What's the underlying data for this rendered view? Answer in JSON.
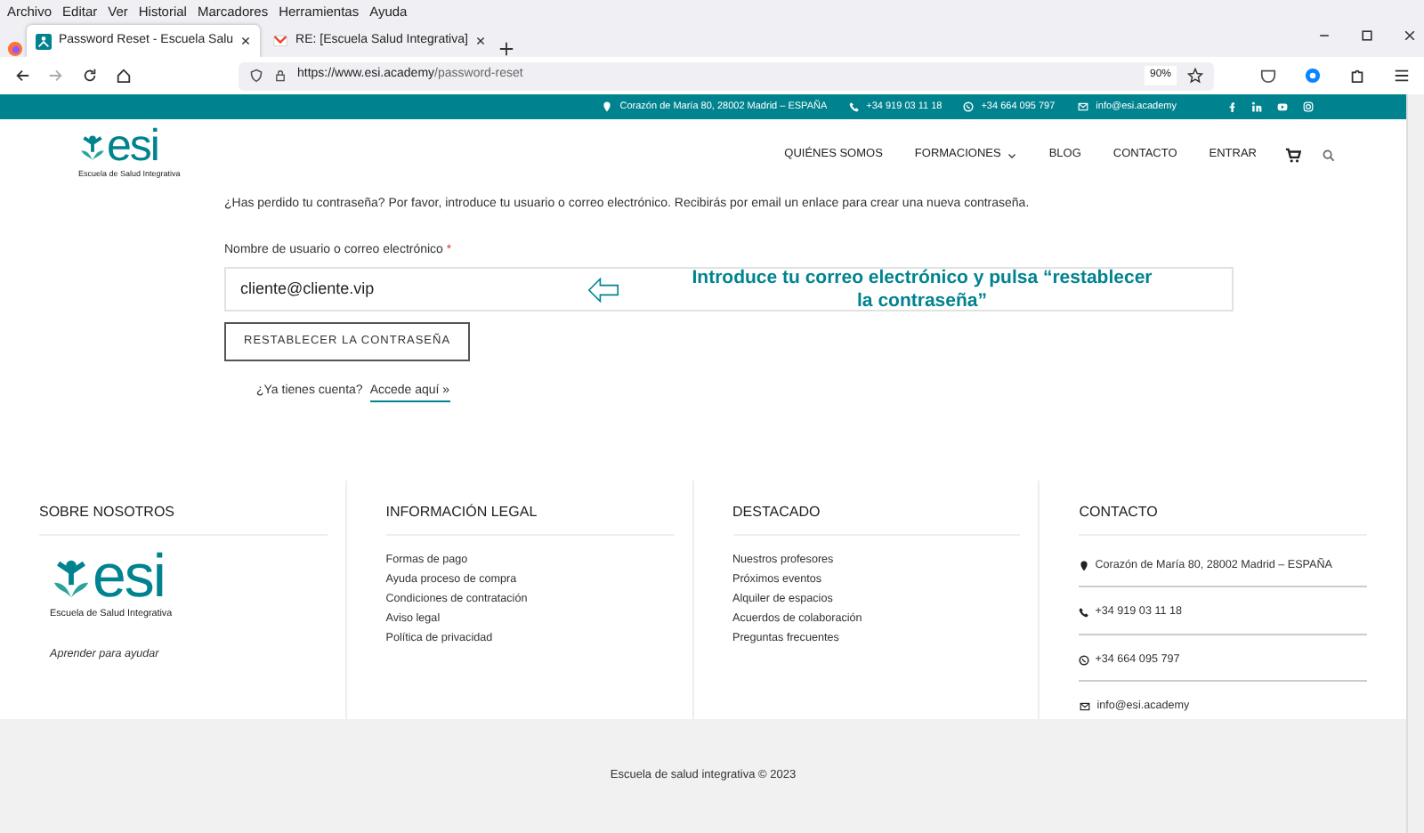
{
  "browser": {
    "menu": [
      "Archivo",
      "Editar",
      "Ver",
      "Historial",
      "Marcadores",
      "Herramientas",
      "Ayuda"
    ],
    "tabs": [
      {
        "title": "Password Reset - Escuela Salu",
        "selected": true
      },
      {
        "title": "RE: [Escuela Salud Integrativa]",
        "selected": false
      }
    ],
    "url_host": "https://www.esi.academy",
    "url_path": "/password-reset",
    "zoom": "90%"
  },
  "topbar": {
    "contacts": [
      {
        "kind": "location",
        "text": "Corazón de María 80, 28002 Madrid – ESPAÑA"
      },
      {
        "kind": "phone",
        "text": "+34 919 03 11 18"
      },
      {
        "kind": "whatsapp",
        "text": "+34 664 095 797"
      },
      {
        "kind": "mail",
        "text": "info@esi.academy"
      }
    ]
  },
  "logo": {
    "text": "esi",
    "tagline": "Escuela de Salud Integrativa"
  },
  "nav": [
    {
      "label": "QUIÉNES SOMOS",
      "dropdown": false
    },
    {
      "label": "FORMACIONES",
      "dropdown": true
    },
    {
      "label": "BLOG",
      "dropdown": false
    },
    {
      "label": "CONTACTO",
      "dropdown": false
    },
    {
      "label": "ENTRAR",
      "dropdown": false
    }
  ],
  "form": {
    "intro": "¿Has perdido tu contraseña? Por favor, introduce tu usuario o correo electrónico. Recibirás por email un enlace para crear una nueva contraseña.",
    "label": "Nombre de usuario o correo electrónico",
    "required": "*",
    "value": "cliente@cliente.vip",
    "annotation": "Introduce tu correo electrónico y pulsa “restablecer la contraseña”",
    "button": "RESTABLECER LA CONTRASEÑA",
    "login_prompt": "¿Ya tienes cuenta?",
    "login_link": "Accede aquí »"
  },
  "footer": {
    "about": {
      "title": "SOBRE NOSOTROS",
      "logo_text": "esi",
      "logo_tagline": "Escuela de Salud Integrativa",
      "tagline": "Aprender para ayudar"
    },
    "legal": {
      "title": "INFORMACIÓN LEGAL",
      "links": [
        "Formas de pago",
        "Ayuda proceso de compra",
        "Condiciones de contratación",
        "Aviso legal",
        "Política de privacidad"
      ]
    },
    "featured": {
      "title": "DESTACADO",
      "links": [
        "Nuestros profesores",
        "Próximos eventos",
        "Alquiler de espacios",
        "Acuerdos de colaboración",
        "Preguntas frecuentes"
      ]
    },
    "contact": {
      "title": "CONTACTO",
      "items": [
        {
          "kind": "location",
          "text": "Corazón de María 80, 28002 Madrid – ESPAÑA"
        },
        {
          "kind": "phone",
          "text": "+34 919 03 11 18"
        },
        {
          "kind": "whatsapp",
          "text": "+34 664 095 797"
        },
        {
          "kind": "mail",
          "text": "info@esi.academy"
        }
      ]
    }
  },
  "copyright": "Escuela de salud integrativa © 2023"
}
